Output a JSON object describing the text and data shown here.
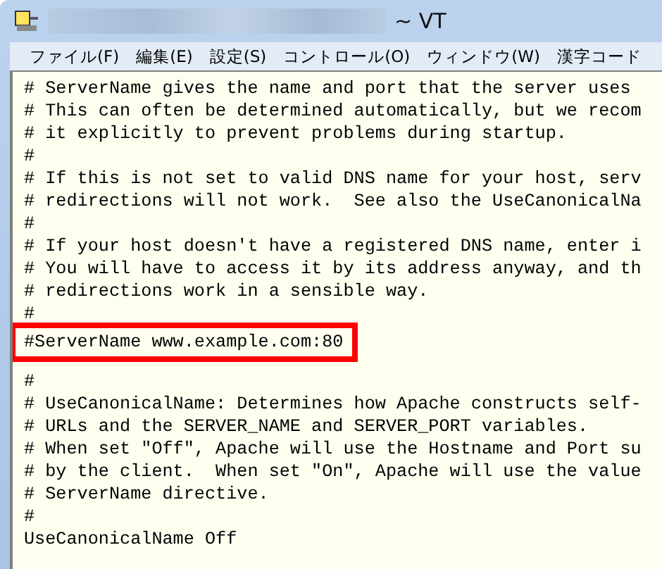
{
  "window": {
    "title": "~ VT"
  },
  "menu": [
    "ファイル(F)",
    "編集(E)",
    "設定(S)",
    "コントロール(O)",
    "ウィンドウ(W)",
    "漢字コード"
  ],
  "lines": [
    {
      "kind": "text",
      "text": "# ServerName gives the name and port that the server uses",
      "highlighted": false
    },
    {
      "kind": "text",
      "text": "# This can often be determined automatically, but we recom",
      "highlighted": false
    },
    {
      "kind": "text",
      "text": "# it explicitly to prevent problems during startup.",
      "highlighted": false
    },
    {
      "kind": "text",
      "text": "#",
      "highlighted": false
    },
    {
      "kind": "text",
      "text": "# If this is not set to valid DNS name for your host, serv",
      "highlighted": false
    },
    {
      "kind": "text",
      "text": "# redirections will not work.  See also the UseCanonicalNa",
      "highlighted": false
    },
    {
      "kind": "text",
      "text": "#",
      "highlighted": false
    },
    {
      "kind": "text",
      "text": "# If your host doesn't have a registered DNS name, enter i",
      "highlighted": false
    },
    {
      "kind": "text",
      "text": "# You will have to access it by its address anyway, and th",
      "highlighted": false
    },
    {
      "kind": "text",
      "text": "# redirections work in a sensible way.",
      "highlighted": false
    },
    {
      "kind": "text",
      "text": "#",
      "highlighted": false
    },
    {
      "kind": "text",
      "text": "#ServerName www.example.com:80",
      "highlighted": true
    },
    {
      "kind": "blank"
    },
    {
      "kind": "text",
      "text": "#",
      "highlighted": false
    },
    {
      "kind": "text",
      "text": "# UseCanonicalName: Determines how Apache constructs self-",
      "highlighted": false
    },
    {
      "kind": "text",
      "text": "# URLs and the SERVER_NAME and SERVER_PORT variables.",
      "highlighted": false
    },
    {
      "kind": "text",
      "text": "# When set \"Off\", Apache will use the Hostname and Port su",
      "highlighted": false
    },
    {
      "kind": "text",
      "text": "# by the client.  When set \"On\", Apache will use the value",
      "highlighted": false
    },
    {
      "kind": "text",
      "text": "# ServerName directive.",
      "highlighted": false
    },
    {
      "kind": "text",
      "text": "#",
      "highlighted": false
    },
    {
      "kind": "text",
      "text": "UseCanonicalName Off",
      "highlighted": false
    }
  ]
}
